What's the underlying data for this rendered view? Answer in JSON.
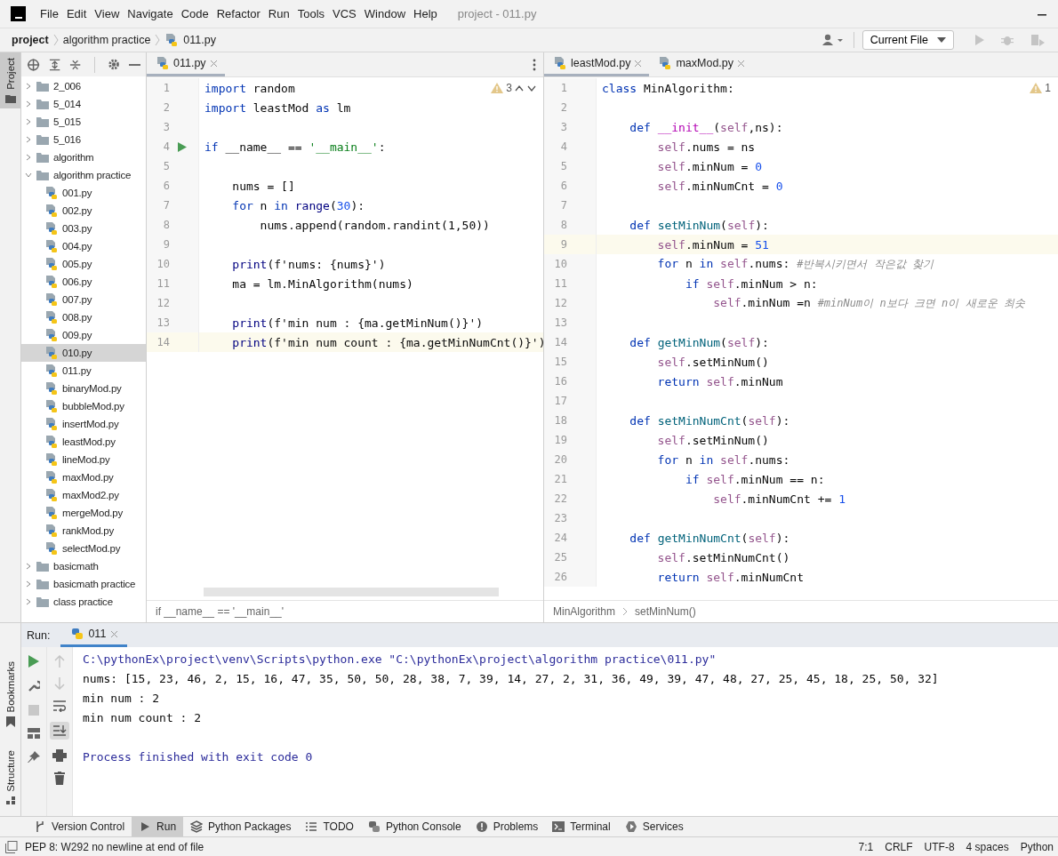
{
  "window": {
    "title": "project - 011.py"
  },
  "menu": [
    "File",
    "Edit",
    "View",
    "Navigate",
    "Code",
    "Refactor",
    "Run",
    "Tools",
    "VCS",
    "Window",
    "Help"
  ],
  "breadcrumbs": [
    {
      "label": "project",
      "bold": true
    },
    {
      "label": "algorithm practice",
      "bold": false
    },
    {
      "label": "011.py",
      "bold": false
    }
  ],
  "run_config": {
    "label": "Current File"
  },
  "side_strip": {
    "top": [
      {
        "label": "Project",
        "selected": true
      }
    ],
    "bottom": [
      {
        "label": "Bookmarks",
        "selected": false
      },
      {
        "label": "Structure",
        "selected": false
      }
    ]
  },
  "project_tree": [
    {
      "name": "2_006",
      "kind": "folder",
      "expanded": false,
      "selected": false
    },
    {
      "name": "5_014",
      "kind": "folder",
      "expanded": false,
      "selected": false
    },
    {
      "name": "5_015",
      "kind": "folder",
      "expanded": false,
      "selected": false
    },
    {
      "name": "5_016",
      "kind": "folder",
      "expanded": false,
      "selected": false
    },
    {
      "name": "algorithm",
      "kind": "folder",
      "expanded": false,
      "selected": false
    },
    {
      "name": "algorithm practice",
      "kind": "folder",
      "expanded": true,
      "selected": false,
      "children": [
        {
          "name": "001.py",
          "kind": "file",
          "selected": false
        },
        {
          "name": "002.py",
          "kind": "file",
          "selected": false
        },
        {
          "name": "003.py",
          "kind": "file",
          "selected": false
        },
        {
          "name": "004.py",
          "kind": "file",
          "selected": false
        },
        {
          "name": "005.py",
          "kind": "file",
          "selected": false
        },
        {
          "name": "006.py",
          "kind": "file",
          "selected": false
        },
        {
          "name": "007.py",
          "kind": "file",
          "selected": false
        },
        {
          "name": "008.py",
          "kind": "file",
          "selected": false
        },
        {
          "name": "009.py",
          "kind": "file",
          "selected": false
        },
        {
          "name": "010.py",
          "kind": "file",
          "selected": true
        },
        {
          "name": "011.py",
          "kind": "file",
          "selected": false
        },
        {
          "name": "binaryMod.py",
          "kind": "file",
          "selected": false
        },
        {
          "name": "bubbleMod.py",
          "kind": "file",
          "selected": false
        },
        {
          "name": "insertMod.py",
          "kind": "file",
          "selected": false
        },
        {
          "name": "leastMod.py",
          "kind": "file",
          "selected": false
        },
        {
          "name": "lineMod.py",
          "kind": "file",
          "selected": false
        },
        {
          "name": "maxMod.py",
          "kind": "file",
          "selected": false
        },
        {
          "name": "maxMod2.py",
          "kind": "file",
          "selected": false
        },
        {
          "name": "mergeMod.py",
          "kind": "file",
          "selected": false
        },
        {
          "name": "rankMod.py",
          "kind": "file",
          "selected": false
        },
        {
          "name": "selectMod.py",
          "kind": "file",
          "selected": false
        }
      ]
    },
    {
      "name": "basicmath",
      "kind": "folder",
      "expanded": false,
      "selected": false
    },
    {
      "name": "basicmath practice",
      "kind": "folder",
      "expanded": false,
      "selected": false
    },
    {
      "name": "class practice",
      "kind": "folder",
      "expanded": false,
      "selected": false
    }
  ],
  "editors": [
    {
      "tabs": [
        {
          "label": "011.py",
          "selected": true
        }
      ],
      "warnings": "3",
      "breadcrumbs": [
        "if __name__ == '__main__'"
      ],
      "lines": [
        {
          "num": "1",
          "current": false,
          "run": false,
          "tokens": [
            {
              "t": "import",
              "kind": "kw"
            },
            {
              "t": " random",
              "kind": "plain"
            }
          ]
        },
        {
          "num": "2",
          "current": false,
          "run": false,
          "tokens": [
            {
              "t": "import",
              "kind": "kw"
            },
            {
              "t": " leastMod ",
              "kind": "plain"
            },
            {
              "t": "as",
              "kind": "kw"
            },
            {
              "t": " lm",
              "kind": "plain"
            }
          ]
        },
        {
          "num": "3",
          "current": false,
          "run": false
        },
        {
          "num": "4",
          "current": false,
          "run": true,
          "tokens": [
            {
              "t": "if",
              "kind": "kw"
            },
            {
              "t": " __name__ == ",
              "kind": "plain"
            },
            {
              "t": "'__main__'",
              "kind": "str"
            },
            {
              "t": ":",
              "kind": "plain"
            }
          ]
        },
        {
          "num": "5",
          "current": false,
          "run": false
        },
        {
          "num": "6",
          "current": false,
          "run": false,
          "tokens": [
            {
              "t": "    nums = []",
              "kind": "plain"
            }
          ]
        },
        {
          "num": "7",
          "current": false,
          "run": false,
          "tokens": [
            {
              "t": "    for",
              "kind": "kw"
            },
            {
              "t": " n ",
              "kind": "plain"
            },
            {
              "t": "in ",
              "kind": "kw"
            },
            {
              "t": "range",
              "kind": "builtin"
            },
            {
              "t": "(",
              "kind": "plain"
            },
            {
              "t": "30",
              "kind": "num"
            },
            {
              "t": "):",
              "kind": "plain"
            }
          ]
        },
        {
          "num": "8",
          "current": false,
          "run": false,
          "tokens": [
            {
              "t": "        nums.append(random.randint(1,50))",
              "kind": "plain"
            }
          ]
        },
        {
          "num": "9",
          "current": false,
          "run": false
        },
        {
          "num": "10",
          "current": false,
          "run": false,
          "tokens": [
            {
              "t": "    print",
              "kind": "builtin"
            },
            {
              "t": "(f'nums: {nums}')",
              "kind": "plain"
            }
          ]
        },
        {
          "num": "11",
          "current": false,
          "run": false,
          "tokens": [
            {
              "t": "    ma = lm.MinAlgorithm(nums)",
              "kind": "plain"
            }
          ]
        },
        {
          "num": "12",
          "current": false,
          "run": false
        },
        {
          "num": "13",
          "current": false,
          "run": false,
          "tokens": [
            {
              "t": "    print",
              "kind": "builtin"
            },
            {
              "t": "(f'min num : {ma.getMinNum()}')",
              "kind": "plain"
            }
          ]
        },
        {
          "num": "14",
          "current": true,
          "run": false,
          "tokens": [
            {
              "t": "    print",
              "kind": "builtin"
            },
            {
              "t": "(f'min num count : {ma.getMinNumCnt()}')",
              "kind": "plain"
            }
          ]
        }
      ]
    },
    {
      "tabs": [
        {
          "label": "leastMod.py",
          "selected": true
        },
        {
          "label": "maxMod.py",
          "selected": false
        }
      ],
      "warnings": "1",
      "breadcrumbs": [
        "MinAlgorithm",
        "setMinNum()"
      ],
      "lines": [
        {
          "num": "1",
          "current": false,
          "run": false,
          "tokens": [
            {
              "t": "class",
              "kind": "kw"
            },
            {
              "t": " MinAlgorithm:",
              "kind": "plain"
            }
          ]
        },
        {
          "num": "2",
          "current": false,
          "run": false
        },
        {
          "num": "3",
          "current": false,
          "run": false,
          "tokens": [
            {
              "t": "    def ",
              "kind": "kw"
            },
            {
              "t": "__init__",
              "kind": "dunder"
            },
            {
              "t": "(",
              "kind": "plain"
            },
            {
              "t": "self",
              "kind": "self"
            },
            {
              "t": ",ns):",
              "kind": "plain"
            }
          ]
        },
        {
          "num": "4",
          "current": false,
          "run": false,
          "tokens": [
            {
              "t": "        self",
              "kind": "self"
            },
            {
              "t": ".nums = ns",
              "kind": "plain"
            }
          ]
        },
        {
          "num": "5",
          "current": false,
          "run": false,
          "tokens": [
            {
              "t": "        self",
              "kind": "self"
            },
            {
              "t": ".minNum = ",
              "kind": "plain"
            },
            {
              "t": "0",
              "kind": "num"
            }
          ]
        },
        {
          "num": "6",
          "current": false,
          "run": false,
          "tokens": [
            {
              "t": "        self",
              "kind": "self"
            },
            {
              "t": ".minNumCnt = ",
              "kind": "plain"
            },
            {
              "t": "0",
              "kind": "num"
            }
          ]
        },
        {
          "num": "7",
          "current": false,
          "run": false
        },
        {
          "num": "8",
          "current": false,
          "run": false,
          "tokens": [
            {
              "t": "    def ",
              "kind": "kw"
            },
            {
              "t": "setMinNum",
              "kind": "fn"
            },
            {
              "t": "(",
              "kind": "plain"
            },
            {
              "t": "self",
              "kind": "self"
            },
            {
              "t": "):",
              "kind": "plain"
            }
          ]
        },
        {
          "num": "9",
          "current": true,
          "run": false,
          "tokens": [
            {
              "t": "        self",
              "kind": "self"
            },
            {
              "t": ".minNum = ",
              "kind": "plain"
            },
            {
              "t": "51",
              "kind": "num"
            }
          ]
        },
        {
          "num": "10",
          "current": false,
          "run": false,
          "tokens": [
            {
              "t": "        for",
              "kind": "kw"
            },
            {
              "t": " n ",
              "kind": "plain"
            },
            {
              "t": "in ",
              "kind": "kw"
            },
            {
              "t": "self",
              "kind": "self"
            },
            {
              "t": ".nums: ",
              "kind": "plain"
            },
            {
              "t": "#반복시키면서 작은값 찾기",
              "kind": "comment"
            }
          ]
        },
        {
          "num": "11",
          "current": false,
          "run": false,
          "tokens": [
            {
              "t": "            if ",
              "kind": "kw"
            },
            {
              "t": "self",
              "kind": "self"
            },
            {
              "t": ".minNum > n:",
              "kind": "plain"
            }
          ]
        },
        {
          "num": "12",
          "current": false,
          "run": false,
          "tokens": [
            {
              "t": "                self",
              "kind": "self"
            },
            {
              "t": ".minNum =n ",
              "kind": "plain"
            },
            {
              "t": "#minNum이 n보다 크면 n이 새로운 최솟",
              "kind": "comment"
            }
          ]
        },
        {
          "num": "13",
          "current": false,
          "run": false
        },
        {
          "num": "14",
          "current": false,
          "run": false,
          "tokens": [
            {
              "t": "    def ",
              "kind": "kw"
            },
            {
              "t": "getMinNum",
              "kind": "fn"
            },
            {
              "t": "(",
              "kind": "plain"
            },
            {
              "t": "self",
              "kind": "self"
            },
            {
              "t": "):",
              "kind": "plain"
            }
          ]
        },
        {
          "num": "15",
          "current": false,
          "run": false,
          "tokens": [
            {
              "t": "        self",
              "kind": "self"
            },
            {
              "t": ".setMinNum()",
              "kind": "plain"
            }
          ]
        },
        {
          "num": "16",
          "current": false,
          "run": false,
          "tokens": [
            {
              "t": "        return ",
              "kind": "kw"
            },
            {
              "t": "self",
              "kind": "self"
            },
            {
              "t": ".minNum",
              "kind": "plain"
            }
          ]
        },
        {
          "num": "17",
          "current": false,
          "run": false
        },
        {
          "num": "18",
          "current": false,
          "run": false,
          "tokens": [
            {
              "t": "    def ",
              "kind": "kw"
            },
            {
              "t": "setMinNumCnt",
              "kind": "fn"
            },
            {
              "t": "(",
              "kind": "plain"
            },
            {
              "t": "self",
              "kind": "self"
            },
            {
              "t": "):",
              "kind": "plain"
            }
          ]
        },
        {
          "num": "19",
          "current": false,
          "run": false,
          "tokens": [
            {
              "t": "        self",
              "kind": "self"
            },
            {
              "t": ".setMinNum()",
              "kind": "plain"
            }
          ]
        },
        {
          "num": "20",
          "current": false,
          "run": false,
          "tokens": [
            {
              "t": "        for",
              "kind": "kw"
            },
            {
              "t": " n ",
              "kind": "plain"
            },
            {
              "t": "in ",
              "kind": "kw"
            },
            {
              "t": "self",
              "kind": "self"
            },
            {
              "t": ".nums:",
              "kind": "plain"
            }
          ]
        },
        {
          "num": "21",
          "current": false,
          "run": false,
          "tokens": [
            {
              "t": "            if ",
              "kind": "kw"
            },
            {
              "t": "self",
              "kind": "self"
            },
            {
              "t": ".minNum == n:",
              "kind": "plain"
            }
          ]
        },
        {
          "num": "22",
          "current": false,
          "run": false,
          "tokens": [
            {
              "t": "                self",
              "kind": "self"
            },
            {
              "t": ".minNumCnt += ",
              "kind": "plain"
            },
            {
              "t": "1",
              "kind": "num"
            }
          ]
        },
        {
          "num": "23",
          "current": false,
          "run": false
        },
        {
          "num": "24",
          "current": false,
          "run": false,
          "tokens": [
            {
              "t": "    def ",
              "kind": "kw"
            },
            {
              "t": "getMinNumCnt",
              "kind": "fn"
            },
            {
              "t": "(",
              "kind": "plain"
            },
            {
              "t": "self",
              "kind": "self"
            },
            {
              "t": "):",
              "kind": "plain"
            }
          ]
        },
        {
          "num": "25",
          "current": false,
          "run": false,
          "tokens": [
            {
              "t": "        self",
              "kind": "self"
            },
            {
              "t": ".setMinNumCnt()",
              "kind": "plain"
            }
          ]
        },
        {
          "num": "26",
          "current": false,
          "run": false,
          "tokens": [
            {
              "t": "        return ",
              "kind": "kw"
            },
            {
              "t": "self",
              "kind": "self"
            },
            {
              "t": ".minNumCnt",
              "kind": "plain"
            }
          ]
        }
      ]
    }
  ],
  "run_panel": {
    "label": "Run:",
    "tabs": [
      {
        "label": "011",
        "selected": true
      }
    ],
    "output": [
      {
        "text": "C:\\pythonEx\\project\\venv\\Scripts\\python.exe \"C:\\pythonEx\\project\\algorithm practice\\011.py\"",
        "kind": "system"
      },
      {
        "text": "nums: [15, 23, 46, 2, 15, 16, 47, 35, 50, 50, 28, 38, 7, 39, 14, 27, 2, 31, 36, 49, 39, 47, 48, 27, 25, 45, 18, 25, 50, 32]",
        "kind": "stdout"
      },
      {
        "text": "min num : 2",
        "kind": "stdout"
      },
      {
        "text": "min num count : 2",
        "kind": "stdout"
      },
      {
        "kind": "blank"
      },
      {
        "text": "Process finished with exit code 0",
        "kind": "system"
      }
    ]
  },
  "tool_tabs": [
    {
      "label": "Version Control",
      "selected": false
    },
    {
      "label": "Run",
      "selected": true
    },
    {
      "label": "Python Packages",
      "selected": false
    },
    {
      "label": "TODO",
      "selected": false
    },
    {
      "label": "Python Console",
      "selected": false
    },
    {
      "label": "Problems",
      "selected": false
    },
    {
      "label": "Terminal",
      "selected": false
    },
    {
      "label": "Services",
      "selected": false
    }
  ],
  "status_bar": {
    "message": "PEP 8: W292 no newline at end of file",
    "items": [
      "7:1",
      "CRLF",
      "UTF-8",
      "4 spaces",
      "Python"
    ]
  }
}
